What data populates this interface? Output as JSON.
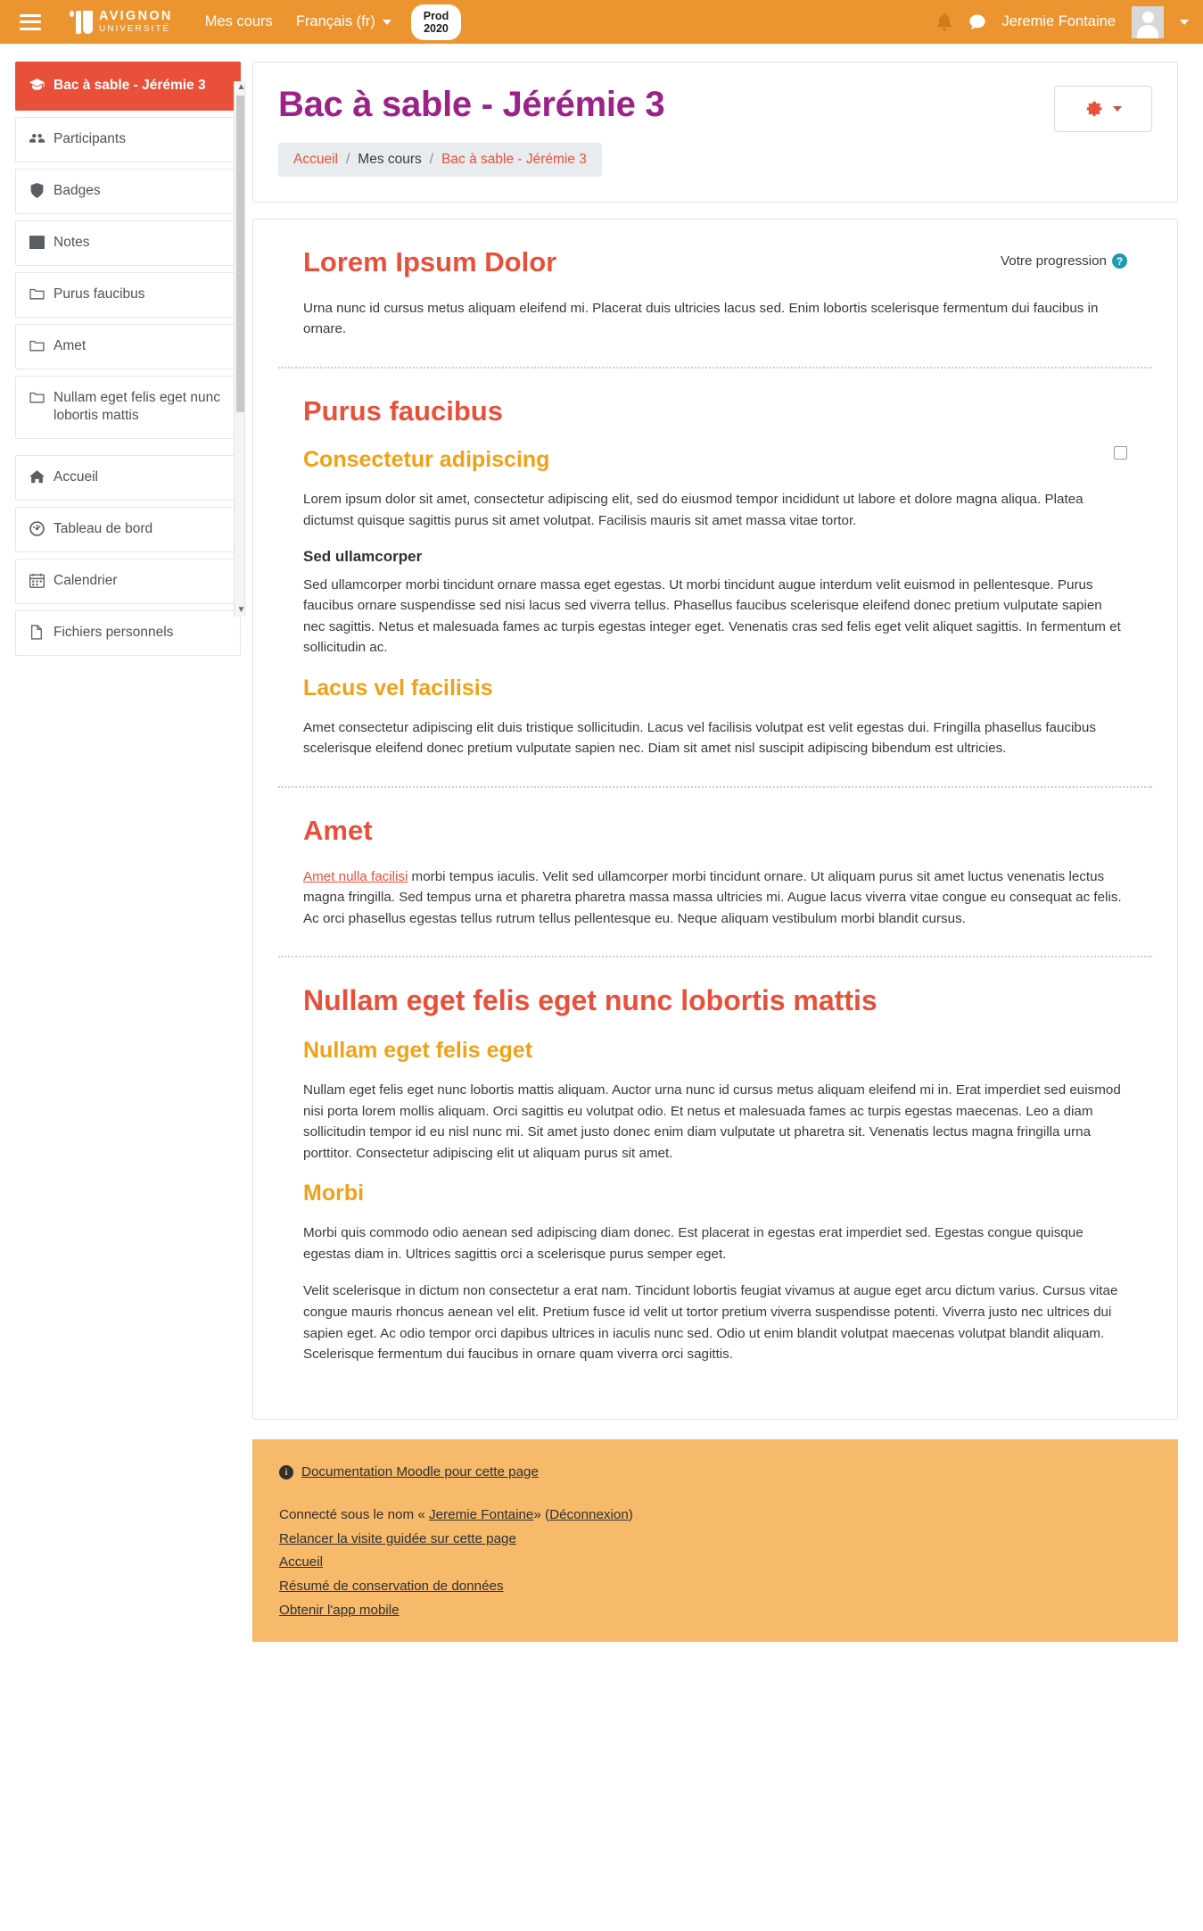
{
  "navbar": {
    "menu_icon": "hamburger-icon",
    "brand_line1": "AVIGNON",
    "brand_line2": "UNIVERSITÉ",
    "my_courses": "Mes cours",
    "language": "Français (fr)",
    "env_badge_line1": "Prod",
    "env_badge_line2": "2020",
    "notifications_icon": "bell-icon",
    "messages_icon": "message-bubble-icon",
    "user_name": "Jeremie Fontaine",
    "avatar_icon": "user-avatar",
    "user_menu_icon": "chevron-down-icon"
  },
  "drawer": {
    "course_items": [
      {
        "label": "Bac à sable - Jérémie 3",
        "icon": "graduation-cap-icon",
        "active": true
      },
      {
        "label": "Participants",
        "icon": "users-icon",
        "active": false
      },
      {
        "label": "Badges",
        "icon": "shield-icon",
        "active": false
      },
      {
        "label": "Notes",
        "icon": "table-grid-icon",
        "active": false
      },
      {
        "label": "Purus faucibus",
        "icon": "folder-icon",
        "active": false
      },
      {
        "label": "Amet",
        "icon": "folder-icon",
        "active": false
      },
      {
        "label": "Nullam eget felis eget nunc lobortis mattis",
        "icon": "folder-icon",
        "active": false
      }
    ],
    "site_items": [
      {
        "label": "Accueil",
        "icon": "home-icon"
      },
      {
        "label": "Tableau de bord",
        "icon": "dashboard-gauge-icon"
      },
      {
        "label": "Calendrier",
        "icon": "calendar-icon"
      },
      {
        "label": "Fichiers personnels",
        "icon": "file-icon"
      }
    ]
  },
  "header": {
    "title": "Bac à sable - Jérémie 3",
    "breadcrumb": [
      {
        "label": "Accueil",
        "link": true
      },
      {
        "label": "Mes cours",
        "link": false
      },
      {
        "label": "Bac à sable - Jérémie 3",
        "link": true
      }
    ],
    "separator": "/",
    "gear_icon": "gear-icon",
    "gear_caret_icon": "caret-down-icon"
  },
  "main": {
    "progress_label": "Votre progression",
    "help_icon": "question-mark-icon",
    "section_general": {
      "title": "Lorem Ipsum Dolor",
      "paragraph": "Urna nunc id cursus metus aliquam eleifend mi. Placerat duis ultricies lacus sed. Enim lobortis scelerisque fermentum dui faucibus in ornare."
    },
    "section_purus": {
      "title": "Purus faucibus",
      "sub1_title": "Consectetur adipiscing",
      "sub1_p1": "Lorem ipsum dolor sit amet, consectetur adipiscing elit, sed do eiusmod tempor incididunt ut labore et dolore magna aliqua. Platea dictumst quisque sagittis purus sit amet volutpat. Facilisis mauris sit amet massa vitae tortor.",
      "sub1_h4": "Sed ullamcorper",
      "sub1_p2": "Sed ullamcorper morbi tincidunt ornare massa eget egestas. Ut morbi tincidunt augue interdum velit euismod in pellentesque. Purus faucibus ornare suspendisse sed nisi lacus sed viverra tellus. Phasellus faucibus scelerisque eleifend donec pretium vulputate sapien nec sagittis. Netus et malesuada fames ac turpis egestas integer eget. Venenatis cras sed felis eget velit aliquet sagittis. In fermentum et sollicitudin ac.",
      "sub2_title": "Lacus vel facilisis",
      "sub2_p1": "Amet consectetur adipiscing elit duis tristique sollicitudin. Lacus vel facilisis volutpat est velit egestas dui. Fringilla phasellus faucibus scelerisque eleifend donec pretium vulputate sapien nec. Diam sit amet nisl suscipit adipiscing bibendum est ultricies.",
      "completion_checkbox": "completion-checkbox"
    },
    "section_amet": {
      "title": "Amet",
      "link_text": "Amet nulla facilisi",
      "paragraph": " morbi tempus iaculis. Velit sed ullamcorper morbi tincidunt ornare. Ut aliquam purus sit amet luctus venenatis lectus magna fringilla. Sed tempus urna et pharetra pharetra massa massa ultricies mi. Augue lacus viverra vitae congue eu consequat ac felis. Ac orci phasellus egestas tellus rutrum tellus pellentesque eu. Neque aliquam vestibulum morbi blandit cursus."
    },
    "section_nullam": {
      "title": "Nullam eget felis eget nunc lobortis mattis",
      "sub1_title": "Nullam eget felis eget",
      "sub1_p1": "Nullam eget felis eget nunc lobortis mattis aliquam. Auctor urna nunc id cursus metus aliquam eleifend mi in. Erat imperdiet sed euismod nisi porta lorem mollis aliquam. Orci sagittis eu volutpat odio. Et netus et malesuada fames ac turpis egestas maecenas. Leo a diam sollicitudin tempor id eu nisl nunc mi. Sit amet justo donec enim diam vulputate ut pharetra sit. Venenatis lectus magna fringilla urna porttitor. Consectetur adipiscing elit ut aliquam purus sit amet.",
      "sub2_title": "Morbi",
      "sub2_p1": "Morbi quis commodo odio aenean sed adipiscing diam donec. Est placerat in egestas erat imperdiet sed. Egestas congue quisque egestas diam in. Ultrices sagittis orci a scelerisque purus semper eget.",
      "sub2_p2": "Velit scelerisque in dictum non consectetur a erat nam. Tincidunt lobortis feugiat vivamus at augue eget arcu dictum varius. Cursus vitae congue mauris rhoncus aenean vel elit. Pretium fusce id velit ut tortor pretium viverra suspendisse potenti. Viverra justo nec ultrices dui sapien eget. Ac odio tempor orci dapibus ultrices in iaculis nunc sed. Odio ut enim blandit volutpat maecenas volutpat blandit aliquam. Scelerisque fermentum dui faucibus in ornare quam viverra orci sagittis."
    }
  },
  "footer": {
    "info_icon": "info-icon",
    "doc_link": "Documentation Moodle pour cette page",
    "logged_prefix": "Connecté sous le nom «",
    "logged_user": "Jeremie Fontaine",
    "logged_mid": "» (",
    "logout_link": "Déconnexion",
    "logged_suffix": ")",
    "links": [
      "Relancer la visite guidée sur cette page",
      "Accueil",
      "Résumé de conservation de données",
      "Obtenir l'app mobile"
    ]
  },
  "colors": {
    "brand_orange": "#eb9430",
    "accent_red": "#e8503a",
    "title_purple": "#9c2287",
    "sub_orange": "#f0a117",
    "footer_orange": "#f7b96a",
    "help_teal": "#1f9ab5"
  }
}
